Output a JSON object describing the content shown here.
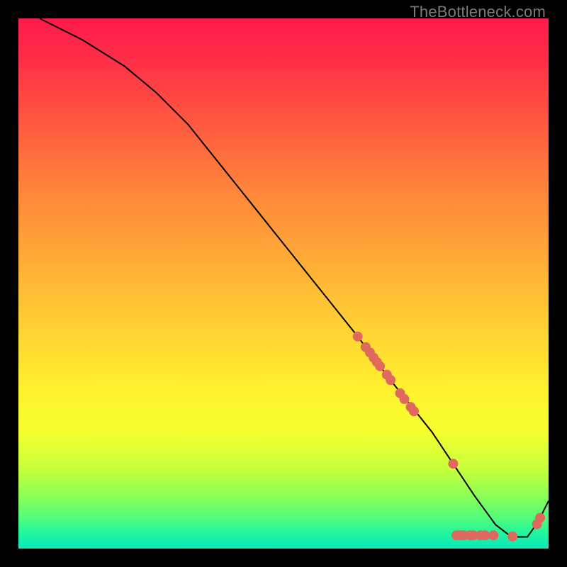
{
  "branding": {
    "text": "TheBottleneck.com"
  },
  "colors": {
    "marker": "#e0695d",
    "curve": "#000000",
    "gradient_top": "#ff1a4b",
    "gradient_bottom": "#0be9bd"
  },
  "chart_data": {
    "type": "line",
    "title": "",
    "xlabel": "",
    "ylabel": "",
    "xlim": [
      0,
      100
    ],
    "ylim": [
      0,
      100
    ],
    "grid": false,
    "curve": {
      "x": [
        4,
        6,
        8,
        12,
        16,
        20,
        26,
        32,
        40,
        48,
        56,
        64,
        70,
        74,
        78,
        82,
        86,
        90,
        93,
        96,
        98,
        100
      ],
      "y": [
        100,
        99,
        98,
        96,
        93.5,
        91,
        86,
        80,
        70,
        60,
        50,
        40,
        32,
        27,
        22,
        16,
        10,
        4.5,
        2.2,
        2.2,
        5,
        9
      ]
    },
    "markers": {
      "x": [
        64,
        65.5,
        66.3,
        67.0,
        67.6,
        68.2,
        69.5,
        70.2,
        72.0,
        72.8,
        74.0,
        74.6,
        82.0,
        82.6,
        83.2,
        84.0,
        85.2,
        85.8,
        87.2,
        88.0,
        89.6,
        93.2,
        97.8,
        98.4
      ],
      "y": [
        40.0,
        38.0,
        37.0,
        36.0,
        35.2,
        34.4,
        32.8,
        31.8,
        29.3,
        28.2,
        26.7,
        25.9,
        16.0,
        2.5,
        2.5,
        2.5,
        2.5,
        2.5,
        2.5,
        2.5,
        2.5,
        2.3,
        4.6,
        5.8
      ]
    }
  }
}
